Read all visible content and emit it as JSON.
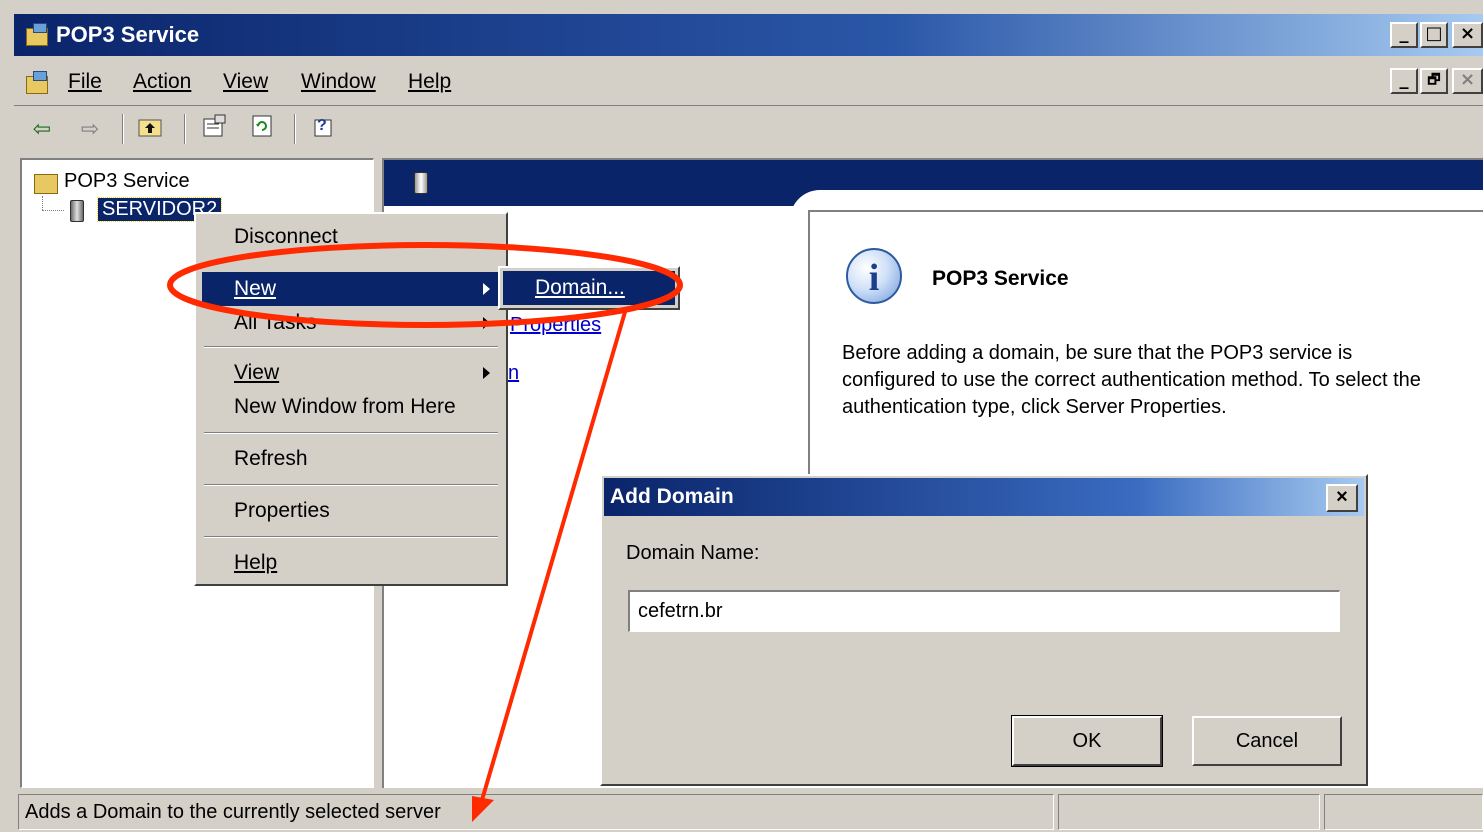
{
  "window": {
    "title": "POP3 Service",
    "controls": {
      "minimize": "_",
      "maximize": "□",
      "close": "×"
    }
  },
  "menubar": {
    "items": [
      "File",
      "Action",
      "View",
      "Window",
      "Help"
    ],
    "child_controls": {
      "minimize": "_",
      "restore": "🗗",
      "close": "×"
    }
  },
  "toolbar": {
    "buttons": [
      "back-icon",
      "forward-icon",
      "up-folder-icon",
      "properties-icon",
      "refresh-icon",
      "help-icon"
    ]
  },
  "tree": {
    "root": "POP3 Service",
    "server": "SERVIDOR2"
  },
  "details": {
    "title": "POP3 Service",
    "description": "Before adding a domain, be sure that the POP3 service is configured to use the correct authentication method. To select the authentication type, click Server Properties.",
    "partial_links": [
      "Properties",
      "n"
    ]
  },
  "context_menu": {
    "items": [
      {
        "label": "Disconnect",
        "submenu": false
      },
      {
        "label": "New",
        "submenu": true,
        "selected": true
      },
      {
        "label": "All Tasks",
        "submenu": true
      },
      {
        "label": "View",
        "submenu": true
      },
      {
        "label": "New Window from Here",
        "submenu": false
      },
      {
        "label": "Refresh",
        "submenu": false
      },
      {
        "label": "Properties",
        "submenu": false
      },
      {
        "label": "Help",
        "submenu": false
      }
    ],
    "submenu_item": "Domain..."
  },
  "dialog": {
    "title": "Add Domain",
    "close": "×",
    "label": "Domain Name:",
    "value": "cefetrn.br",
    "ok": "OK",
    "cancel": "Cancel"
  },
  "statusbar": {
    "text": "Adds a Domain to the currently selected server"
  },
  "colors": {
    "titlebar": "#0a246a",
    "selection": "#0a246a",
    "annotation": "#ff2a00",
    "face": "#d4d0c8"
  }
}
